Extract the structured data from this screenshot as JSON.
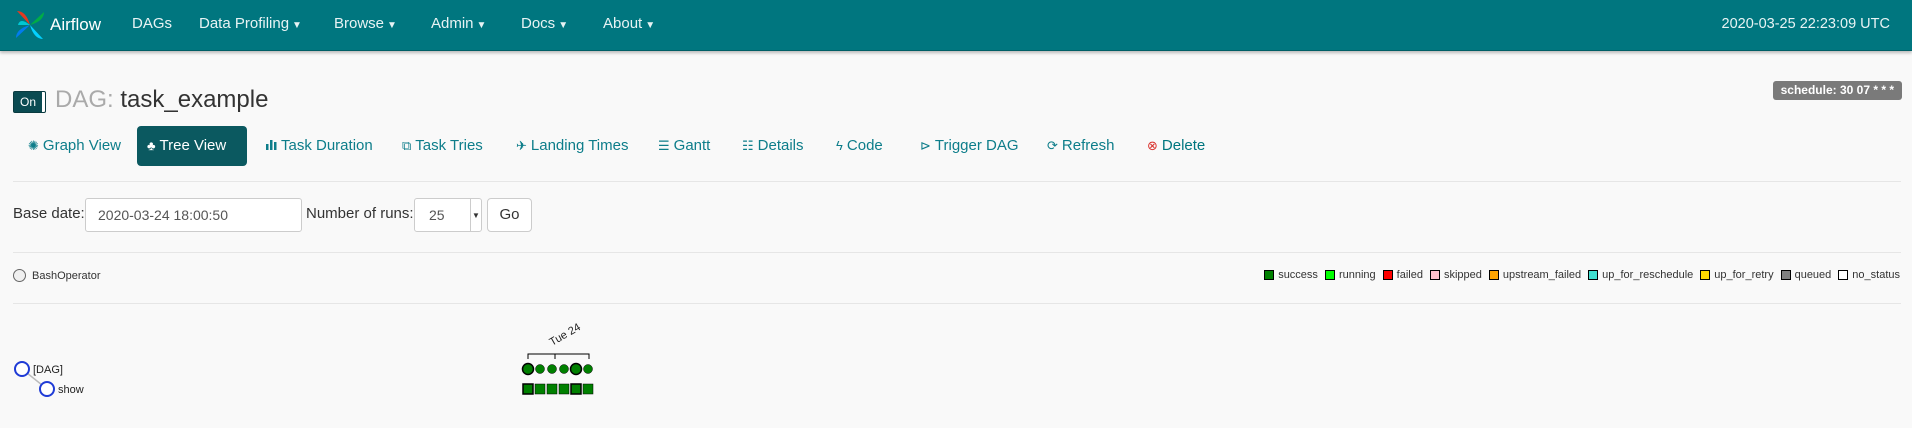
{
  "navbar": {
    "brand": "Airflow",
    "items": [
      {
        "label": "DAGs",
        "dropdown": false
      },
      {
        "label": "Data Profiling",
        "dropdown": true
      },
      {
        "label": "Browse",
        "dropdown": true
      },
      {
        "label": "Admin",
        "dropdown": true
      },
      {
        "label": "Docs",
        "dropdown": true
      },
      {
        "label": "About",
        "dropdown": true
      }
    ],
    "clock": "2020-03-25 22:23:09 UTC"
  },
  "header": {
    "toggle_label": "On",
    "dag_prefix": "DAG:",
    "dag_id": "task_example",
    "schedule": "schedule: 30 07 * * *"
  },
  "tabs": [
    {
      "label": "Graph View",
      "icon": "asterisk-icon"
    },
    {
      "label": "Tree View",
      "icon": "tree-icon",
      "active": true
    },
    {
      "label": "Task Duration",
      "icon": "bar-chart-icon"
    },
    {
      "label": "Task Tries",
      "icon": "duplicate-icon"
    },
    {
      "label": "Landing Times",
      "icon": "plane-icon"
    },
    {
      "label": "Gantt",
      "icon": "align-left-icon"
    },
    {
      "label": "Details",
      "icon": "list-icon"
    },
    {
      "label": "Code",
      "icon": "flash-icon"
    },
    {
      "label": "Trigger DAG",
      "icon": "play-circle-icon"
    },
    {
      "label": "Refresh",
      "icon": "refresh-icon"
    },
    {
      "label": "Delete",
      "icon": "remove-circle-icon"
    }
  ],
  "form": {
    "base_date_label": "Base date:",
    "base_date_value": "2020-03-24 18:00:50",
    "runs_label": "Number of runs:",
    "runs_value": "25",
    "go_label": "Go"
  },
  "operator_label": "BashOperator",
  "legend": [
    {
      "label": "success",
      "color": "#008000"
    },
    {
      "label": "running",
      "color": "#00ff00"
    },
    {
      "label": "failed",
      "color": "#ff0000"
    },
    {
      "label": "skipped",
      "color": "#ffc0cb"
    },
    {
      "label": "upstream_failed",
      "color": "#ffa500"
    },
    {
      "label": "up_for_reschedule",
      "color": "#40e0d0"
    },
    {
      "label": "up_for_retry",
      "color": "#ffd700"
    },
    {
      "label": "queued",
      "color": "#808080"
    },
    {
      "label": "no_status",
      "color": "#ffffff"
    }
  ],
  "tree": {
    "date_label": "Tue 24",
    "nodes": [
      "[DAG]",
      "show"
    ],
    "run_count": 6,
    "run_states": [
      "success",
      "success",
      "success",
      "success",
      "success",
      "success"
    ],
    "selected_runs": [
      0,
      4
    ]
  }
}
